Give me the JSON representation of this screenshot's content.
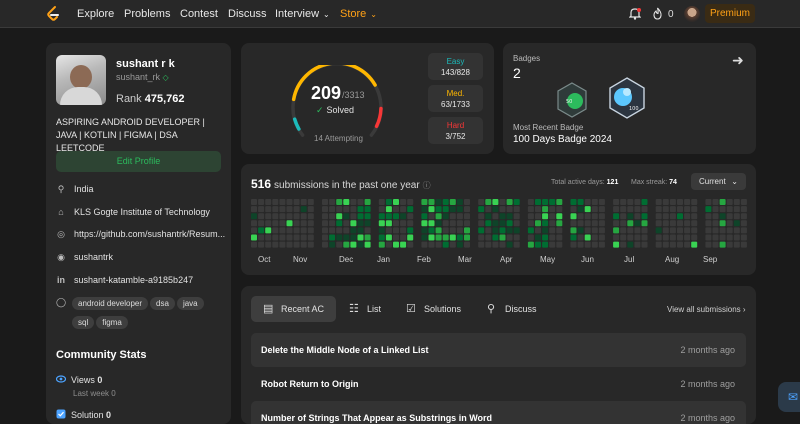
{
  "nav": {
    "items": [
      "Explore",
      "Problems",
      "Contest",
      "Discuss",
      "Interview",
      "Store"
    ],
    "flame_count": "0",
    "premium_label": "Premium"
  },
  "profile": {
    "name": "sushant r k",
    "handle": "sushant_rk",
    "rank_label": "Rank",
    "rank_value": "475,762",
    "bio": "ASPIRING ANDROID DEVELOPER | JAVA | KOTLIN | FIGMA | DSA LEETCODE",
    "edit_label": "Edit Profile",
    "location": "India",
    "school": "KLS Gogte Institute of Technology",
    "website": "https://github.com/sushantrk/Resum...",
    "github": "sushantrk",
    "linkedin": "sushant-katamble-a9185b247",
    "tags": [
      "android developer",
      "dsa",
      "java",
      "sql",
      "figma"
    ]
  },
  "community": {
    "title": "Community Stats",
    "views_label": "Views",
    "views_value": "0",
    "views_sub": "Last week 0",
    "solution_label": "Solution",
    "solution_value": "0"
  },
  "solved": {
    "count": "209",
    "total": "/3313",
    "label": "Solved",
    "attempting": "14 Attempting",
    "easy_label": "Easy",
    "easy_value": "143/828",
    "easy_color": "#1cbaba",
    "med_label": "Med.",
    "med_value": "63/1733",
    "med_color": "#ffb700",
    "hard_label": "Hard",
    "hard_value": "3/752",
    "hard_color": "#f63737",
    "easy_fraction": 0.173,
    "med_fraction": 0.036,
    "hard_fraction": 0.004
  },
  "badges": {
    "label": "Badges",
    "count": "2",
    "recent_label": "Most Recent Badge",
    "recent_name": "100 Days Badge 2024",
    "badge_texts": [
      "50",
      "100"
    ]
  },
  "submissions": {
    "count": "516",
    "title_rest": "submissions in the past one year",
    "active_label": "Total active days:",
    "active_value": "121",
    "streak_label": "Max streak:",
    "streak_value": "74",
    "selector": "Current",
    "months": [
      "Oct",
      "Nov",
      "Dec",
      "Jan",
      "Feb",
      "Mar",
      "Apr",
      "May",
      "Jun",
      "Jul",
      "Aug",
      "Sep"
    ]
  },
  "recent": {
    "tabs": [
      "Recent AC",
      "List",
      "Solutions",
      "Discuss"
    ],
    "view_all": "View all submissions",
    "rows": [
      {
        "title": "Delete the Middle Node of a Linked List",
        "ago": "2 months ago"
      },
      {
        "title": "Robot Return to Origin",
        "ago": "2 months ago"
      },
      {
        "title": "Number of Strings That Appear as Substrings in Word",
        "ago": "2 months ago"
      }
    ]
  }
}
